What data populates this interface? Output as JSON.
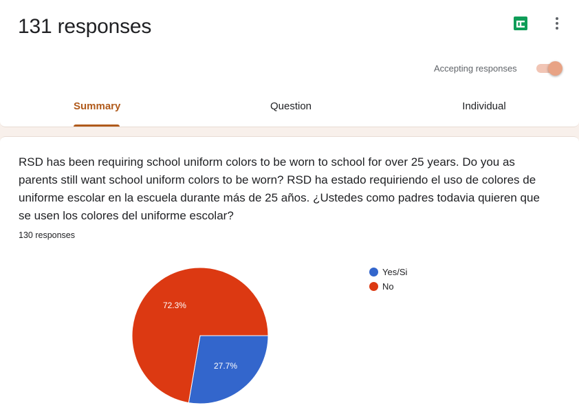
{
  "header": {
    "title": "131 responses",
    "accepting_label": "Accepting responses",
    "accepting_on": true
  },
  "tabs": [
    {
      "label": "Summary",
      "active": true
    },
    {
      "label": "Question",
      "active": false
    },
    {
      "label": "Individual",
      "active": false
    }
  ],
  "question": {
    "text": "RSD has been requiring school uniform colors to be worn to school for over 25 years. Do you as parents still want school uniform colors to be worn? RSD ha estado requiriendo el uso de colores de uniforme escolar en la escuela durante más de 25 años. ¿Ustedes como padres todavia quieren que se usen los colores del uniforme escolar?",
    "responses_label": "130 responses"
  },
  "colors": {
    "accent": "#b05a1b",
    "yes": "#3366cc",
    "no": "#dc3912",
    "sheets_green": "#0f9d58"
  },
  "icons": {
    "sheets": "sheets-icon",
    "more": "more-vert-icon"
  },
  "chart_data": {
    "type": "pie",
    "categories": [
      "Yes/Si",
      "No"
    ],
    "values": [
      27.7,
      72.3
    ],
    "labels": [
      "27.7%",
      "72.3%"
    ],
    "colors": [
      "#3366cc",
      "#dc3912"
    ],
    "legend": "right"
  }
}
